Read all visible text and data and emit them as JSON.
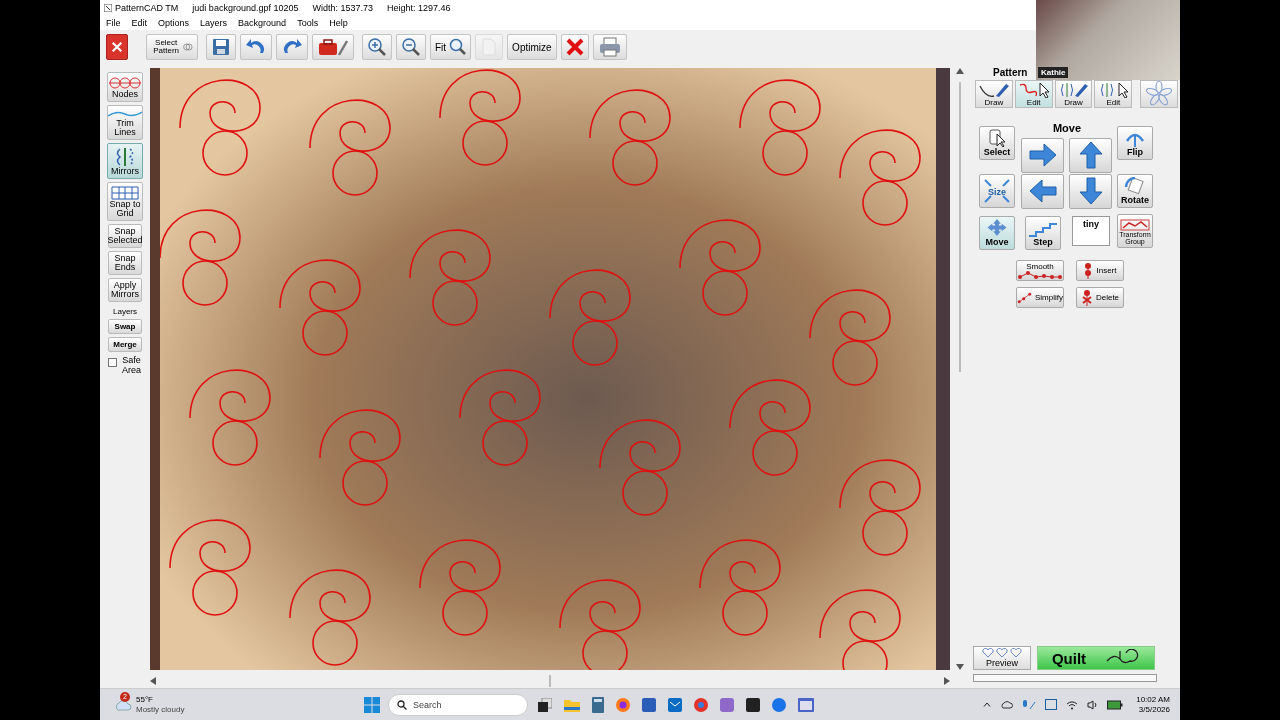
{
  "window": {
    "app": "PatternCAD TM",
    "file": "judi background.gpf 10205",
    "width": "Width: 1537.73",
    "height": "Height: 1297.46"
  },
  "menu": [
    "File",
    "Edit",
    "Options",
    "Layers",
    "Background",
    "Tools",
    "Help"
  ],
  "toolbar": [
    {
      "kind": "close"
    },
    {
      "kind": "select_pattern",
      "label": "Select Pattern"
    },
    {
      "kind": "save"
    },
    {
      "kind": "undo"
    },
    {
      "kind": "redo"
    },
    {
      "kind": "toolbox"
    },
    {
      "kind": "zoom_in"
    },
    {
      "kind": "zoom_out"
    },
    {
      "kind": "fit",
      "label": "Fit"
    },
    {
      "kind": "page",
      "disabled": true
    },
    {
      "kind": "text",
      "label": "Optimize"
    },
    {
      "kind": "delete"
    },
    {
      "kind": "print"
    }
  ],
  "left_tools": [
    {
      "kind": "nodes",
      "label": "Nodes",
      "selected": false
    },
    {
      "kind": "trim",
      "label": "Trim Lines",
      "selected": false
    },
    {
      "kind": "mirrors",
      "label": "Mirrors",
      "selected": true
    },
    {
      "kind": "grid",
      "label": "Snap to Grid",
      "selected": false
    },
    {
      "kind": "text",
      "label": "Snap Selected",
      "selected": false
    },
    {
      "kind": "text",
      "label": "Snap Ends",
      "selected": false
    },
    {
      "kind": "text",
      "label": "Apply Mirrors",
      "selected": false
    }
  ],
  "layers": {
    "heading": "Layers",
    "buttons": [
      "Swap",
      "Merge"
    ]
  },
  "safe_area": {
    "label": "Safe Area",
    "checked": false
  },
  "video": {
    "name": "Kathie"
  },
  "panel": {
    "heading": "Pattern",
    "tabs": [
      {
        "kind": "pattern_draw",
        "label": "Draw",
        "selected": false
      },
      {
        "kind": "pattern_edit",
        "label": "Edit",
        "selected": true
      },
      {
        "kind": "mirror_draw",
        "label": "Draw",
        "selected": false
      },
      {
        "kind": "mirror_edit",
        "label": "Edit",
        "selected": false
      },
      {
        "kind": "star",
        "selected": false
      }
    ],
    "move_heading": "Move",
    "select": {
      "label": "Select"
    },
    "flip": {
      "label": "Flip"
    },
    "size": {
      "label": "Size"
    },
    "rotate": {
      "label": "Rotate"
    },
    "move": {
      "label": "Move",
      "selected": true
    },
    "step": {
      "label": "Step"
    },
    "step_field": {
      "value": "tiny"
    },
    "transform": {
      "label": "Transform Group"
    },
    "node_tools": [
      {
        "kind": "smooth",
        "label": "Smooth"
      },
      {
        "kind": "insert",
        "label": "Insert"
      },
      {
        "kind": "simplify",
        "label": "Simplify"
      },
      {
        "kind": "delete",
        "label": "Delete"
      }
    ],
    "preview": {
      "label": "Preview"
    },
    "quilt": {
      "label": "Quilt"
    },
    "progress": {
      "level": 0
    }
  },
  "taskbar": {
    "weather": {
      "badge": "2",
      "temp": "55°F",
      "desc": "Mostly cloudy"
    },
    "search": {
      "placeholder": "Search"
    },
    "time": "10:02 AM",
    "date": "3/5/2026"
  }
}
